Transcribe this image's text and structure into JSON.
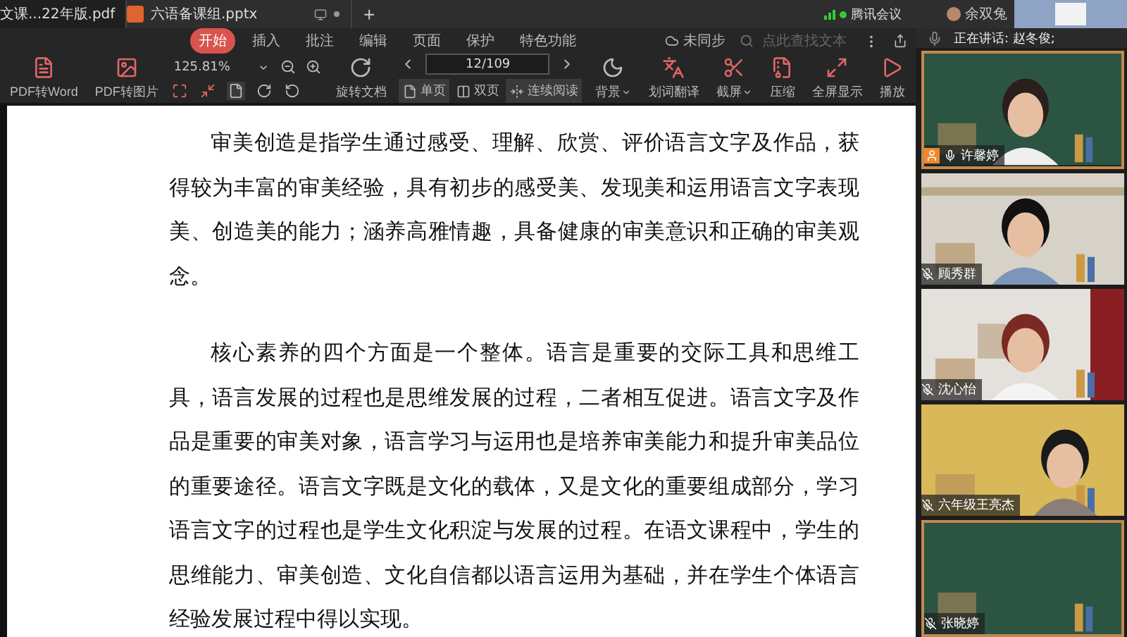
{
  "tabs": [
    {
      "title": "文课...22年版.pdf",
      "selected": true,
      "kind": "pdf"
    },
    {
      "title": "六语备课组.pptx",
      "selected": false,
      "kind": "pptx"
    }
  ],
  "new_tab": "+",
  "menu": [
    {
      "label": "开始",
      "selected": true
    },
    {
      "label": "插入",
      "selected": false
    },
    {
      "label": "批注",
      "selected": false
    },
    {
      "label": "编辑",
      "selected": false
    },
    {
      "label": "页面",
      "selected": false
    },
    {
      "label": "保护",
      "selected": false
    },
    {
      "label": "特色功能",
      "selected": false
    }
  ],
  "sync_status": "未同步",
  "search": {
    "placeholder": "点此查找文本"
  },
  "toolbar": {
    "convert": [
      {
        "label": "PDF转Word"
      },
      {
        "label": "PDF转图片"
      }
    ],
    "zoom": "125.81%",
    "rotate": "旋转文档",
    "page": "12/109",
    "view_modes": [
      {
        "label": "单页",
        "selected": true
      },
      {
        "label": "双页",
        "selected": false
      },
      {
        "label": "连续阅读",
        "selected": true
      }
    ],
    "tools": [
      {
        "label": "背景",
        "dropdown": true
      },
      {
        "label": "划词翻译",
        "dropdown": false
      },
      {
        "label": "截屏",
        "dropdown": true
      },
      {
        "label": "压缩",
        "dropdown": false
      },
      {
        "label": "全屏显示",
        "dropdown": false
      },
      {
        "label": "播放",
        "dropdown": false
      }
    ]
  },
  "document": {
    "paragraphs": [
      "审美创造是指学生通过感受、理解、欣赏、评价语言文字及作品，获得较为丰富的审美经验，具有初步的感受美、发现美和运用语言文字表现美、创造美的能力；涵养高雅情趣，具备健康的审美意识和正确的审美观念。",
      "核心素养的四个方面是一个整体。语言是重要的交际工具和思维工具，语言发展的过程也是思维发展的过程，二者相互促进。语言文字及作品是重要的审美对象，语言学习与运用也是培养审美能力和提升审美品位的重要途径。语言文字既是文化的载体，又是文化的重要组成部分，学习语言文字的过程也是学生文化积淀与发展的过程。在语文课程中，学生的思维能力、审美创造、文化自信都以语言运用为基础，并在学生个体语言经验发展过程中得以实现。"
    ]
  },
  "meeting": {
    "app": "腾讯会议",
    "user": "余双兔",
    "speaking": "正在讲话: 赵冬俊;",
    "participants": [
      {
        "name": "许馨婷",
        "muted": false,
        "host": true
      },
      {
        "name": "顾秀群",
        "muted": true,
        "host": false
      },
      {
        "name": "沈心怡",
        "muted": true,
        "host": false
      },
      {
        "name": "六年级王亮杰",
        "muted": true,
        "host": false
      },
      {
        "name": "张晓婷",
        "muted": true,
        "host": false
      }
    ]
  }
}
